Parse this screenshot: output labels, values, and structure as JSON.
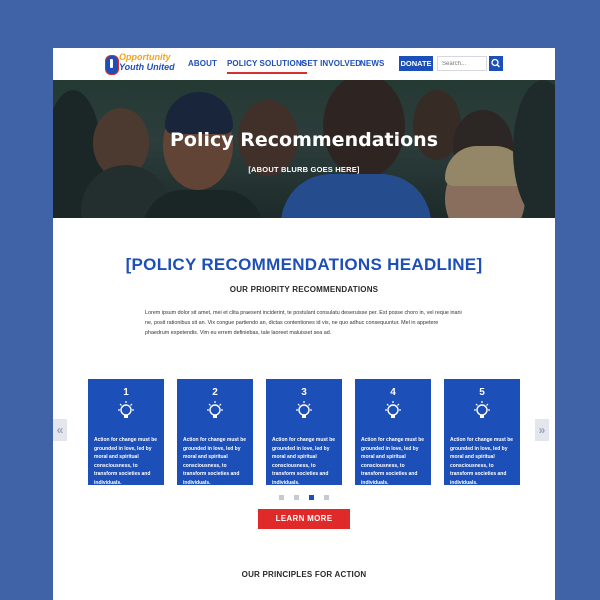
{
  "header": {
    "logo": {
      "line1": "Opportunity",
      "line2": "Youth United"
    },
    "nav": [
      {
        "label": "ABOUT",
        "active": false
      },
      {
        "label": "POLICY SOLUTIONS",
        "active": true
      },
      {
        "label": "GET INVOLVED",
        "active": false
      },
      {
        "label": "NEWS",
        "active": false
      }
    ],
    "donate_label": "DONATE",
    "search_placeholder": "Search...",
    "search_icon": "search-icon"
  },
  "hero": {
    "title": "Policy Recommendations",
    "subtitle": "[ABOUT BLURB GOES HERE]"
  },
  "main": {
    "headline": "[POLICY RECOMMENDATIONS HEADLINE]",
    "subheading": "OUR PRIORITY RECOMMENDATIONS",
    "body": "Lorem ipsum dolor sit amet, mei et clita praesent inciderint, te postulant consulatu deseruisse per. Est posse choro in, vel reque inani ne, posit rationibus sit an. Vix congue partiendo an, dictas contentiones id vis, ne quo adhuc consequuntur. Mel in appetere phaedrum expetendis. Vim eu errem definiebas, tale laoreet maluisset sea ad.",
    "cards": [
      {
        "number": "1",
        "icon": "lightbulb-icon",
        "text": "Action for change must be grounded in love, led by moral and spiritual consciousness, to transform societies and individuals."
      },
      {
        "number": "2",
        "icon": "lightbulb-icon",
        "text": "Action for change must be grounded in love, led by moral and spiritual consciousness, to transform societies and individuals."
      },
      {
        "number": "3",
        "icon": "lightbulb-icon",
        "text": "Action for change must be grounded in love, led by moral and spiritual consciousness, to transform societies and individuals."
      },
      {
        "number": "4",
        "icon": "lightbulb-icon",
        "text": "Action for change must be grounded in love, led by moral and spiritual consciousness, to transform societies and individuals."
      },
      {
        "number": "5",
        "icon": "lightbulb-icon",
        "text": "Action for change must be grounded in love, led by moral and spiritual consciousness, to transform societies and individuals."
      }
    ],
    "carousel_active_index": 3,
    "carousel_prev_glyph": "«",
    "carousel_next_glyph": "»",
    "learn_more_label": "LEARN MORE",
    "principles_heading": "OUR PRINCIPLES FOR ACTION"
  },
  "colors": {
    "background": "#3f63a6",
    "brand_blue": "#1d4fb8",
    "accent_red": "#e02a2a",
    "logo_orange": "#f2a51b"
  }
}
